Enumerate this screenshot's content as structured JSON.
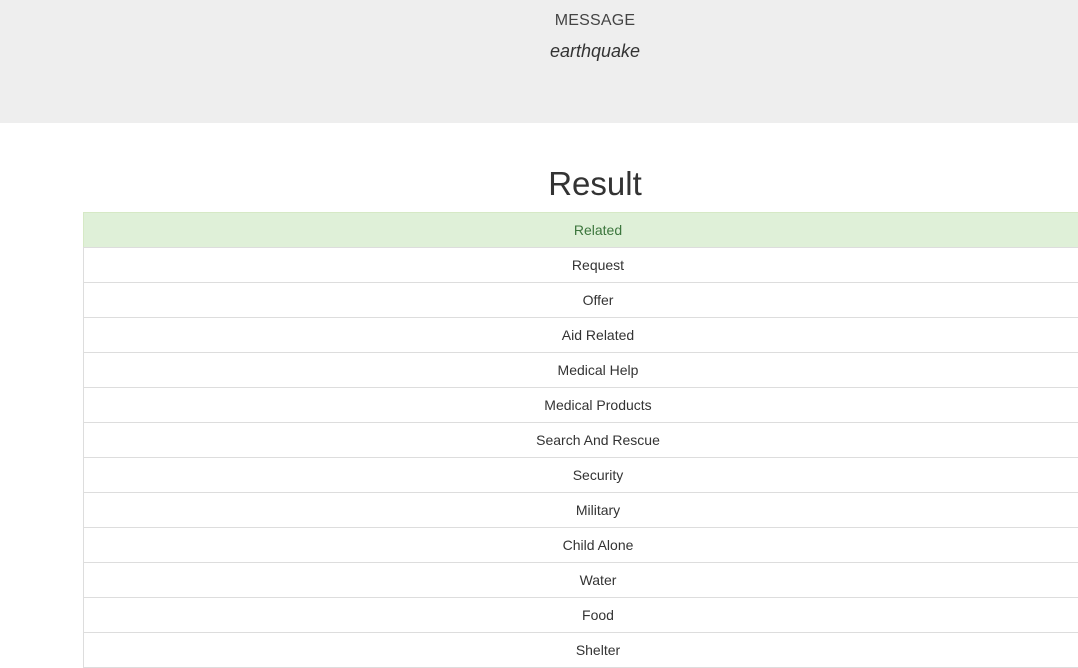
{
  "header": {
    "label": "MESSAGE",
    "message": "earthquake"
  },
  "result": {
    "title": "Result",
    "categories": [
      {
        "label": "Related",
        "positive": true
      },
      {
        "label": "Request",
        "positive": false
      },
      {
        "label": "Offer",
        "positive": false
      },
      {
        "label": "Aid Related",
        "positive": false
      },
      {
        "label": "Medical Help",
        "positive": false
      },
      {
        "label": "Medical Products",
        "positive": false
      },
      {
        "label": "Search And Rescue",
        "positive": false
      },
      {
        "label": "Security",
        "positive": false
      },
      {
        "label": "Military",
        "positive": false
      },
      {
        "label": "Child Alone",
        "positive": false
      },
      {
        "label": "Water",
        "positive": false
      },
      {
        "label": "Food",
        "positive": false
      },
      {
        "label": "Shelter",
        "positive": false
      }
    ]
  },
  "colors": {
    "header_background": "#eeeeee",
    "positive_background": "#dff0d8",
    "positive_text": "#3c763d",
    "row_border": "#dddddd"
  }
}
